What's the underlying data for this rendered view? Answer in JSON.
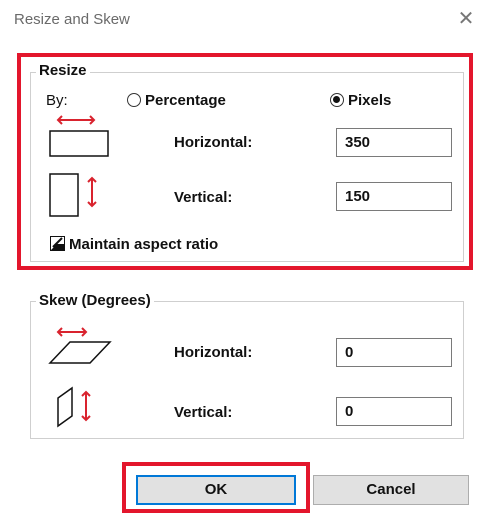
{
  "window": {
    "title": "Resize and Skew",
    "close_glyph": "✕"
  },
  "resize": {
    "legend": "Resize",
    "by_label": "By:",
    "options": [
      {
        "label": "Percentage",
        "selected": false
      },
      {
        "label": "Pixels",
        "selected": true
      }
    ],
    "horizontal_label": "Horizontal:",
    "horizontal_value": "350",
    "vertical_label": "Vertical:",
    "vertical_value": "150",
    "maintain_aspect_label": "Maintain aspect ratio",
    "maintain_aspect_checked": true
  },
  "skew": {
    "legend": "Skew (Degrees)",
    "horizontal_label": "Horizontal:",
    "horizontal_value": "0",
    "vertical_label": "Vertical:",
    "vertical_value": "0"
  },
  "buttons": {
    "ok": "OK",
    "cancel": "Cancel"
  },
  "icons": {
    "resize_horizontal": "resize-horizontal-icon",
    "resize_vertical": "resize-vertical-icon",
    "skew_horizontal": "skew-horizontal-icon",
    "skew_vertical": "skew-vertical-icon",
    "checkmark": "checkmark-icon"
  },
  "colors": {
    "highlight": "#e3162c",
    "arrow": "#d9232e",
    "button_focus": "#0078d7"
  }
}
